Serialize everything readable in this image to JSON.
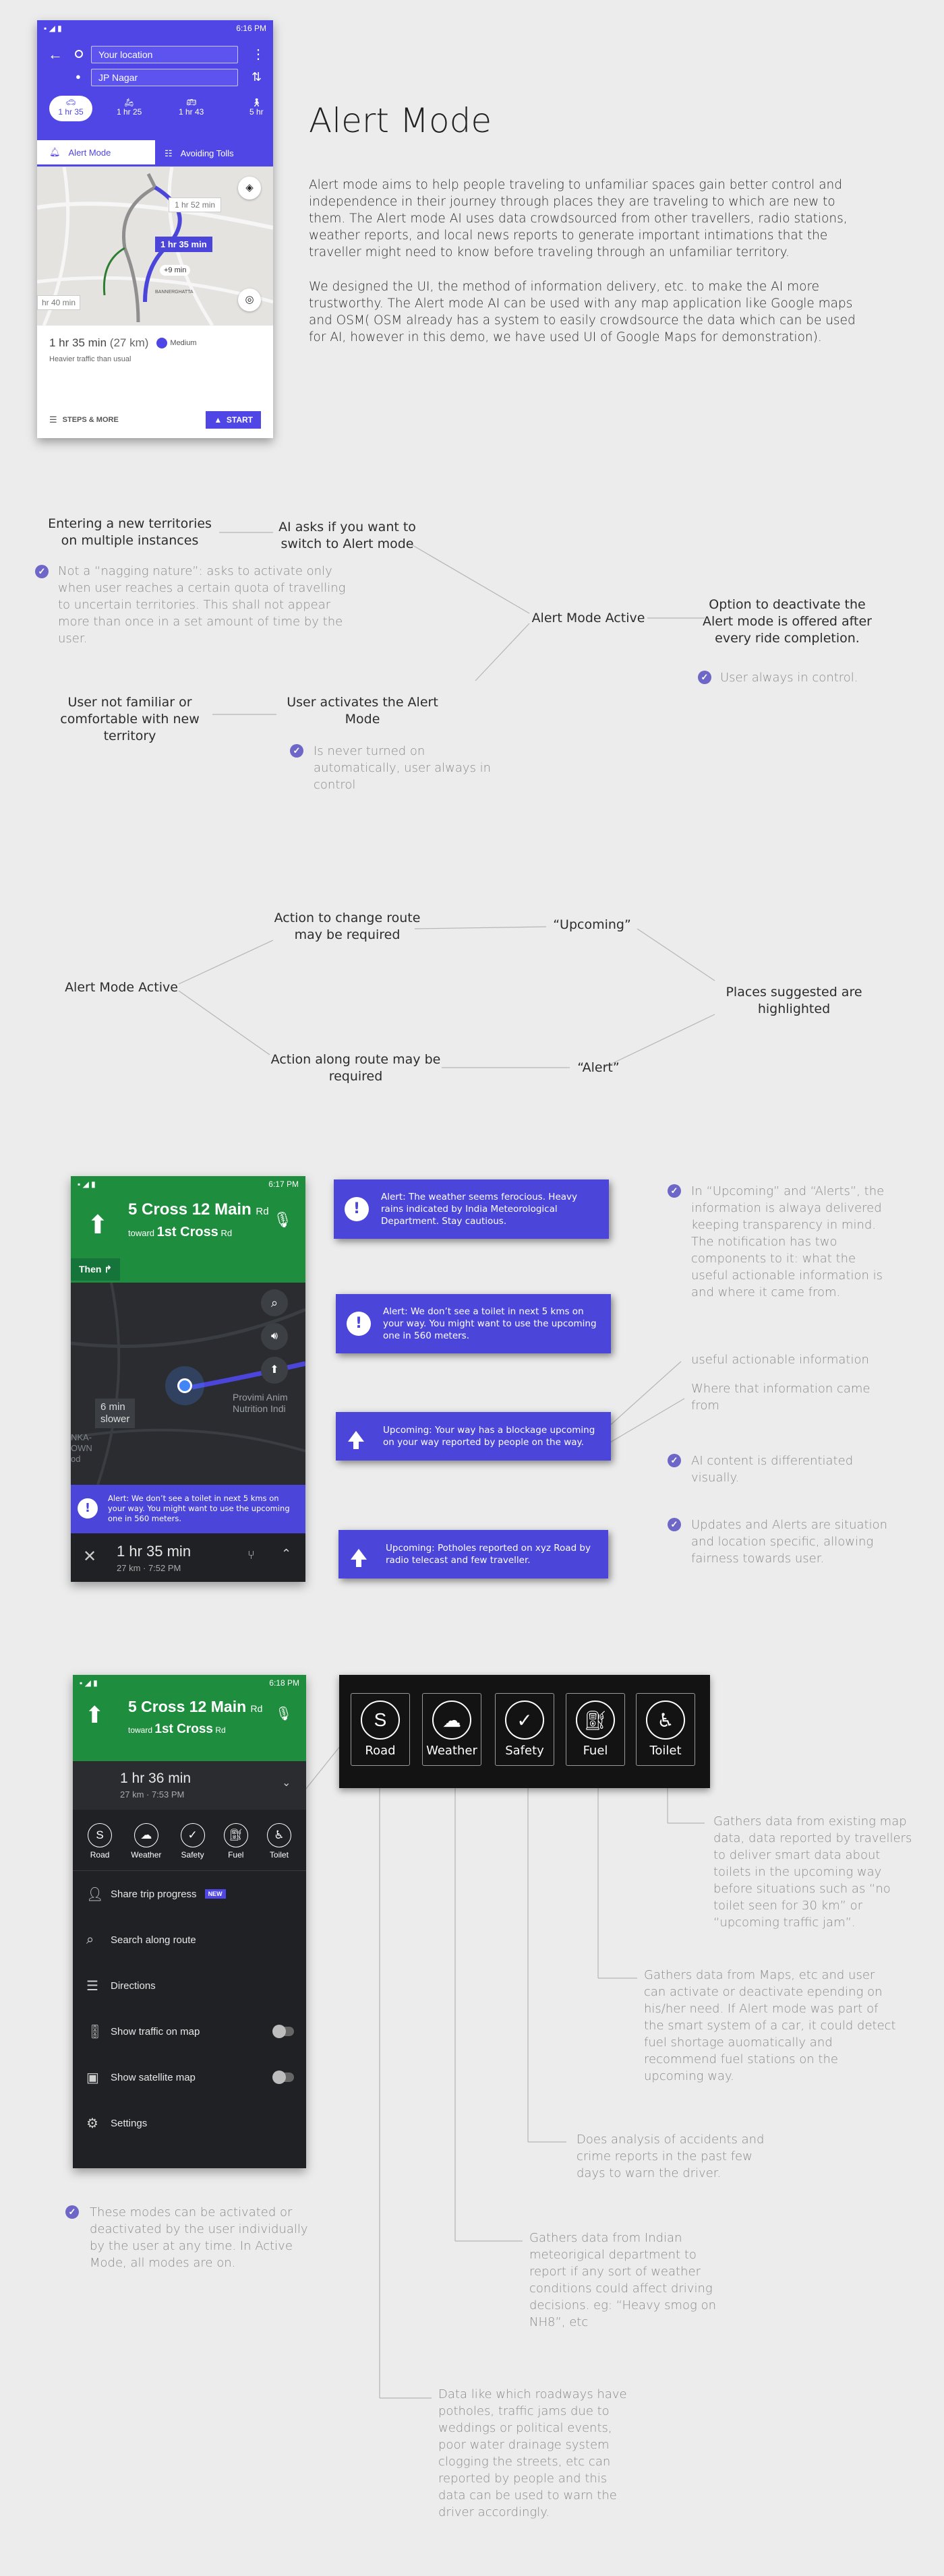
{
  "header": {
    "title": "Alert Mode",
    "para1": "Alert mode aims to help people traveling to unfamiliar spaces gain better control and independence in their journey through places they are traveling to which are new to them. The Alert mode AI uses data crowdsourced from other travellers, radio stations, weather reports, and local news reports to generate important intimations that the traveller might need to know before traveling through an unfamiliar territory.",
    "para2": "We designed the UI, the method of information delivery, etc. to make the AI more trustworthy. The Alert mode AI can be used with any map application like Google maps and OSM( OSM already has a system to easily crowdsource the data which can be used for AI, however in this demo, we have used UI of Google Maps for demonstration)."
  },
  "phone1": {
    "time": "6:16 PM",
    "from": "Your location",
    "to": "JP Nagar",
    "modes": [
      "1 hr 35",
      "1 hr 25",
      "1 hr 43",
      "5 hr"
    ],
    "tab_alert": "Alert Mode",
    "tab_tolls": "Avoiding Tolls",
    "route_alt": "1 hr 52 min",
    "route_main": "1 hr 35 min",
    "route_plus": "+9 min",
    "route_left": "hr 40 min",
    "place1": "BANNERGHATTA",
    "summary": "1 hr 35 min",
    "distance": "(27 km)",
    "badge": "Medium",
    "traffic": "Heavier traffic than usual",
    "steps": "STEPS & MORE",
    "start": "START"
  },
  "flow1": {
    "n1": "Entering a new territories on multiple instances",
    "n2": "AI asks if you want to switch to Alert mode",
    "n3": "Alert Mode Active",
    "n4": "Option to deactivate the Alert mode is offered after every ride completion.",
    "n5": "User not familiar or comfortable with new territory",
    "n6": "User activates the Alert Mode",
    "note1": "Not a “nagging nature”: asks to activate only when user reaches a certain quota of travelling to uncertain territories. This shall not appear more than once in a set amount of time by the user.",
    "note2": "User always in control.",
    "note3": "Is never turned on automatically, user always in control"
  },
  "flow2": {
    "n1": "Alert Mode Active",
    "n2": "Action to change route may be required",
    "n3": "Action along route may be required",
    "n4": "“Upcoming”",
    "n5": "“Alert”",
    "n6": "Places suggested are highlighted"
  },
  "phone2": {
    "time": "6:17 PM",
    "street": "5 Cross 12 Main",
    "street_suffix": "Rd",
    "toward": "toward",
    "toward_street": "1st Cross",
    "toward_suffix": "Rd",
    "then": "Then",
    "slower_top": "6 min",
    "slower_bot": "slower",
    "poi": "Provimi Anim Nutrition Indi",
    "edge1": "NKA-",
    "edge2": "OWN",
    "edge3": "od",
    "alert": "Alert: We don’t see a toilet in next 5 kms on your way. You might want to use the upcoming one in 560 meters.",
    "eta": "1 hr 35 min",
    "eta_sub": "27 km · 7:52 PM"
  },
  "cards": [
    "Alert: The weather seems ferocious. Heavy rains indicated by India Meteorological Department. Stay cautious.",
    "Alert: We don’t see a toilet in next 5 kms on your way. You might want to use the upcoming one in 560 meters.",
    "Upcoming: Your way has a blockage upcoming on your way reported by people on the way.",
    "Upcoming: Potholes reported on xyz Road by radio telecast and few traveller."
  ],
  "notes3": {
    "a": "In “Upcoming” and “Alerts”, the information is alwaya delivered keeping transparency in mind. The notification has two components to it: what the useful actionable information is and where it came from.",
    "b": "useful actionable information",
    "c": "Where that information came from",
    "d": "AI content is differentiated visually.",
    "e": "Updates and Alerts are situation and location specific, allowing fairness towards user."
  },
  "phone3": {
    "time": "6:18 PM",
    "street": "5 Cross 12 Main",
    "street_suffix": "Rd",
    "toward": "toward",
    "toward_street": "1st Cross",
    "toward_suffix": "Rd",
    "eta": "1 hr 36 min",
    "eta_sub": "27 km · 7:53 PM",
    "modes": [
      "Road",
      "Weather",
      "Safety",
      "Fuel",
      "Toilet"
    ],
    "menu": [
      "Share trip progress",
      "Search along route",
      "Directions",
      "Show traffic on map",
      "Show satellite map",
      "Settings"
    ],
    "new_badge": "NEW"
  },
  "big_modes": [
    "Road",
    "Weather",
    "Safety",
    "Fuel",
    "Toilet"
  ],
  "notes4": {
    "toilet": "Gathers data from existing map data, data reported by travellers to deliver smart data about toilets in the upcoming way before situations such as “no toilet seen for 30 km” or “upcoming traffic jam”.",
    "fuel": "Gathers data from Maps, etc and user can activate or deactivate epending on his/her need. If Alert mode was part of the smart system of a car, it could detect fuel shortage auomatically and recommend fuel stations on the upcoming way.",
    "safety": "Does analysis of accidents and crime reports in the past few days to warn the driver.",
    "weather": "Gathers data from Indian meteorigical department to report if any sort of weather conditions could affect driving decisions. eg: “Heavy smog on NH8”, etc",
    "road": "Data like which roadways have potholes, traffic jams due to weddings or political events, poor water drainage system clogging the streets, etc can reported by people  and this data can be used to warn the driver accordingly.",
    "modes_note": "These modes can be activated or deactivated by the user individually by the user at any time. In Active Mode, all modes are on."
  },
  "colors": {
    "purple": "#5046e5",
    "green": "#1e8e3e",
    "dark": "#222222",
    "check": "#6e67c8"
  }
}
